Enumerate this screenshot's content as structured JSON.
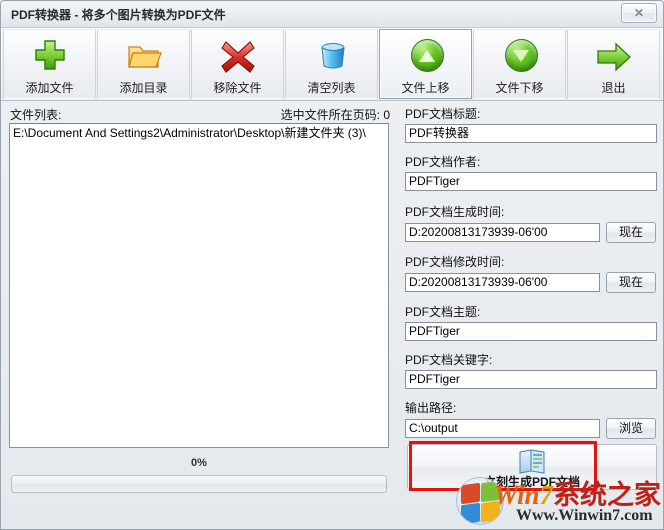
{
  "window": {
    "title": "PDF转换器 - 将多个图片转换为PDF文件",
    "close_label": "✕"
  },
  "toolbar": {
    "buttons": [
      {
        "label": "添加文件",
        "icon": "green-plus-icon",
        "selected": false
      },
      {
        "label": "添加目录",
        "icon": "yellow-folder-icon",
        "selected": false
      },
      {
        "label": "移除文件",
        "icon": "red-x-icon",
        "selected": false
      },
      {
        "label": "清空列表",
        "icon": "blue-trash-icon",
        "selected": false
      },
      {
        "label": "文件上移",
        "icon": "green-up-arrow-icon",
        "selected": true
      },
      {
        "label": "文件下移",
        "icon": "green-down-arrow-icon",
        "selected": false
      },
      {
        "label": "退出",
        "icon": "green-right-arrow-icon",
        "selected": false
      }
    ]
  },
  "left_panel": {
    "file_list_label": "文件列表:",
    "page_number_label": "选中文件所在页码: 0",
    "files": [
      "E:\\Document And Settings2\\Administrator\\Desktop\\新建文件夹 (3)\\"
    ],
    "progress_percent_label": "0%",
    "progress_value": 0
  },
  "right_panel": {
    "fields": [
      {
        "label": "PDF文档标题:",
        "value": "PDF转换器",
        "button": null
      },
      {
        "label": "PDF文档作者:",
        "value": "PDFTiger",
        "button": null
      },
      {
        "label": "PDF文档生成时间:",
        "value": "D:20200813173939-06'00",
        "button": "现在"
      },
      {
        "label": "PDF文档修改时间:",
        "value": "D:20200813173939-06'00",
        "button": "现在"
      },
      {
        "label": "PDF文档主题:",
        "value": "PDFTiger",
        "button": null
      },
      {
        "label": "PDF文档关键字:",
        "value": "PDFTiger",
        "button": null
      },
      {
        "label": "输出路径:",
        "value": "C:\\output",
        "button": "浏览"
      }
    ],
    "generate_button": {
      "label": "立刻生成PDF文档",
      "icon": "pdf-document-icon",
      "highlight_color": "#e8120c"
    }
  },
  "watermark": {
    "brand_win": "Win",
    "brand_seven": "7",
    "brand_cn": "系统之家",
    "url": "Www.Winwin7.com"
  }
}
